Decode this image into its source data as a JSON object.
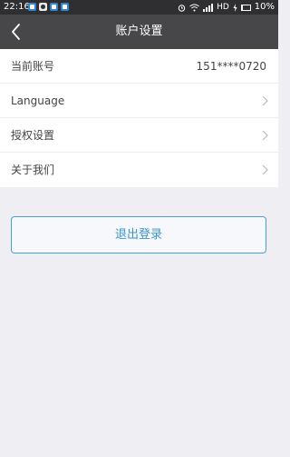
{
  "status_bar": {
    "time": "22:16",
    "network_label": "HD",
    "battery_label": "10%",
    "app_icons": [
      "app-notification-icon",
      "bear-app-icon",
      "app-notification-icon",
      "app-notification-icon"
    ]
  },
  "header": {
    "title": "账户设置",
    "back_icon": "chevron-left-icon"
  },
  "settings": {
    "account": {
      "label": "当前账号",
      "value": "151****0720"
    },
    "items": [
      {
        "label": "Language",
        "icon": "chevron-right-icon"
      },
      {
        "label": "授权设置",
        "icon": "chevron-right-icon"
      },
      {
        "label": "关于我们",
        "icon": "chevron-right-icon"
      }
    ]
  },
  "logout": {
    "label": "退出登录"
  },
  "colors": {
    "status_bar_bg": "#2f2f31",
    "header_bg": "#474749",
    "page_bg": "#efeef3",
    "accent": "#3d94cc"
  }
}
